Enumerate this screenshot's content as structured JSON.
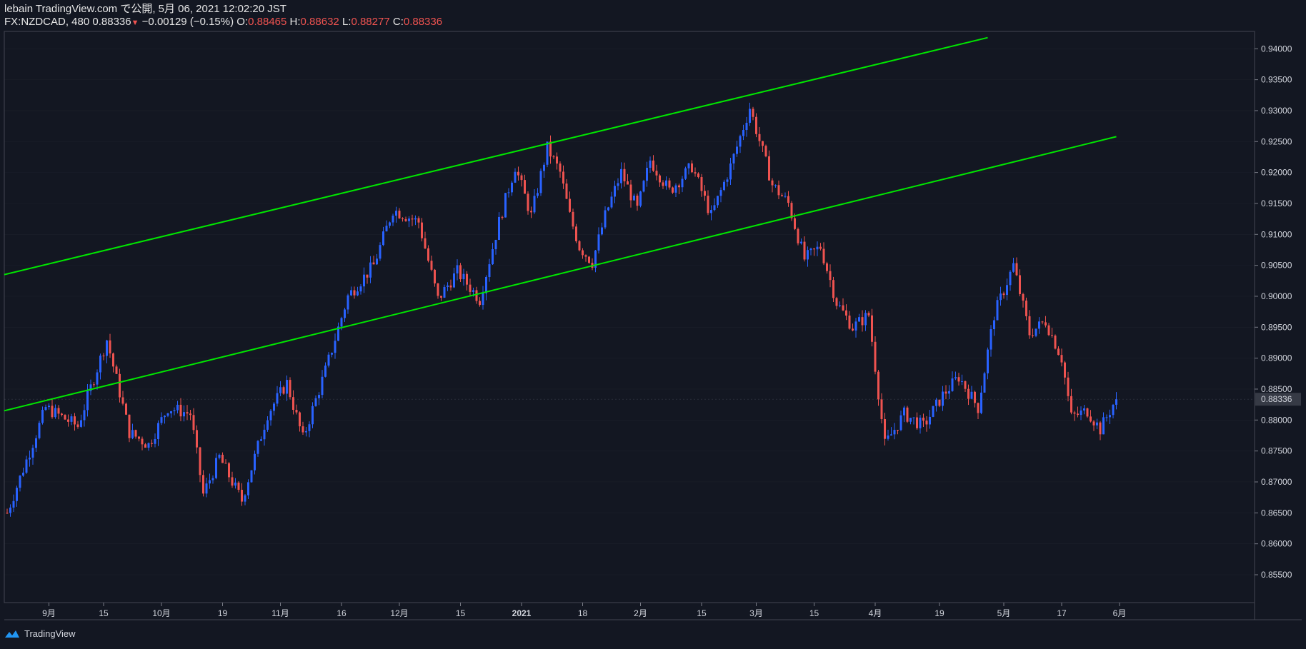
{
  "header": {
    "line1": "lebain TradingView.com で公開, 5月 06, 2021 12:02:20 JST",
    "symbol": "FX:NZDCAD, 480",
    "last": "0.88336",
    "change": "−0.00129 (−0.15%)",
    "o_label": "O:",
    "o_value": "0.88465",
    "h_label": "H:",
    "h_value": "0.88632",
    "l_label": "L:",
    "l_value": "0.88277",
    "c_label": "C:",
    "c_value": "0.88336"
  },
  "footer": {
    "brand": "TradingView",
    "icon": "tradingview-logo-icon"
  },
  "colors": {
    "background": "#131722",
    "up": "#2962ff",
    "down": "#ef5350",
    "trendline": "#00e600",
    "grid": "#2a2e39",
    "last_price_tag": "#363a45"
  },
  "chart_data": {
    "type": "line",
    "symbol": "FX:NZDCAD",
    "interval": "480",
    "ylim": [
      0.8505,
      0.9428
    ],
    "y_ticks": [
      "0.94000",
      "0.93500",
      "0.93000",
      "0.92500",
      "0.92000",
      "0.91500",
      "0.91000",
      "0.90500",
      "0.90000",
      "0.89500",
      "0.89000",
      "0.88500",
      "0.88000",
      "0.87500",
      "0.87000",
      "0.86500",
      "0.86000",
      "0.85500"
    ],
    "x_ticks": [
      "9月",
      "15",
      "10月",
      "19",
      "11月",
      "16",
      "12月",
      "15",
      "2021",
      "18",
      "2月",
      "15",
      "3月",
      "15",
      "4月",
      "19",
      "5月",
      "17",
      "6月"
    ],
    "last_price": "0.88336",
    "series": [
      {
        "x_index": [
          0,
          12,
          22,
          31,
          38,
          44,
          50,
          57,
          61,
          66,
          73,
          81,
          87,
          92,
          99,
          106,
          114,
          120,
          128,
          134,
          140,
          147,
          153,
          158,
          163,
          168,
          172,
          175,
          178,
          182,
          186,
          191,
          196,
          200,
          206,
          213,
          219,
          225,
          231,
          238,
          243,
          248,
          253,
          258,
          263,
          268,
          273,
          279,
          285,
          291,
          296,
          302,
          307,
          313,
          318,
          323,
          328,
          331,
          336,
          340,
          345
        ],
        "close": [
          0.865,
          0.882,
          0.879,
          0.893,
          0.878,
          0.876,
          0.882,
          0.881,
          0.868,
          0.874,
          0.867,
          0.881,
          0.886,
          0.877,
          0.888,
          0.9,
          0.905,
          0.914,
          0.912,
          0.8995,
          0.904,
          0.8995,
          0.912,
          0.921,
          0.913,
          0.924,
          0.92,
          0.913,
          0.908,
          0.9055,
          0.913,
          0.92,
          0.914,
          0.922,
          0.917,
          0.921,
          0.913,
          0.921,
          0.9305,
          0.918,
          0.915,
          0.906,
          0.908,
          0.899,
          0.895,
          0.897,
          0.876,
          0.881,
          0.879,
          0.884,
          0.887,
          0.882,
          0.897,
          0.905,
          0.894,
          0.896,
          0.89,
          0.8805,
          0.8815,
          0.8785,
          0.8835
        ]
      }
    ],
    "trendlines": [
      {
        "x": [
          0,
          305
        ],
        "y": [
          0.9035,
          0.9418
        ]
      },
      {
        "x": [
          0,
          345
        ],
        "y": [
          0.8815,
          0.9258
        ]
      }
    ]
  }
}
